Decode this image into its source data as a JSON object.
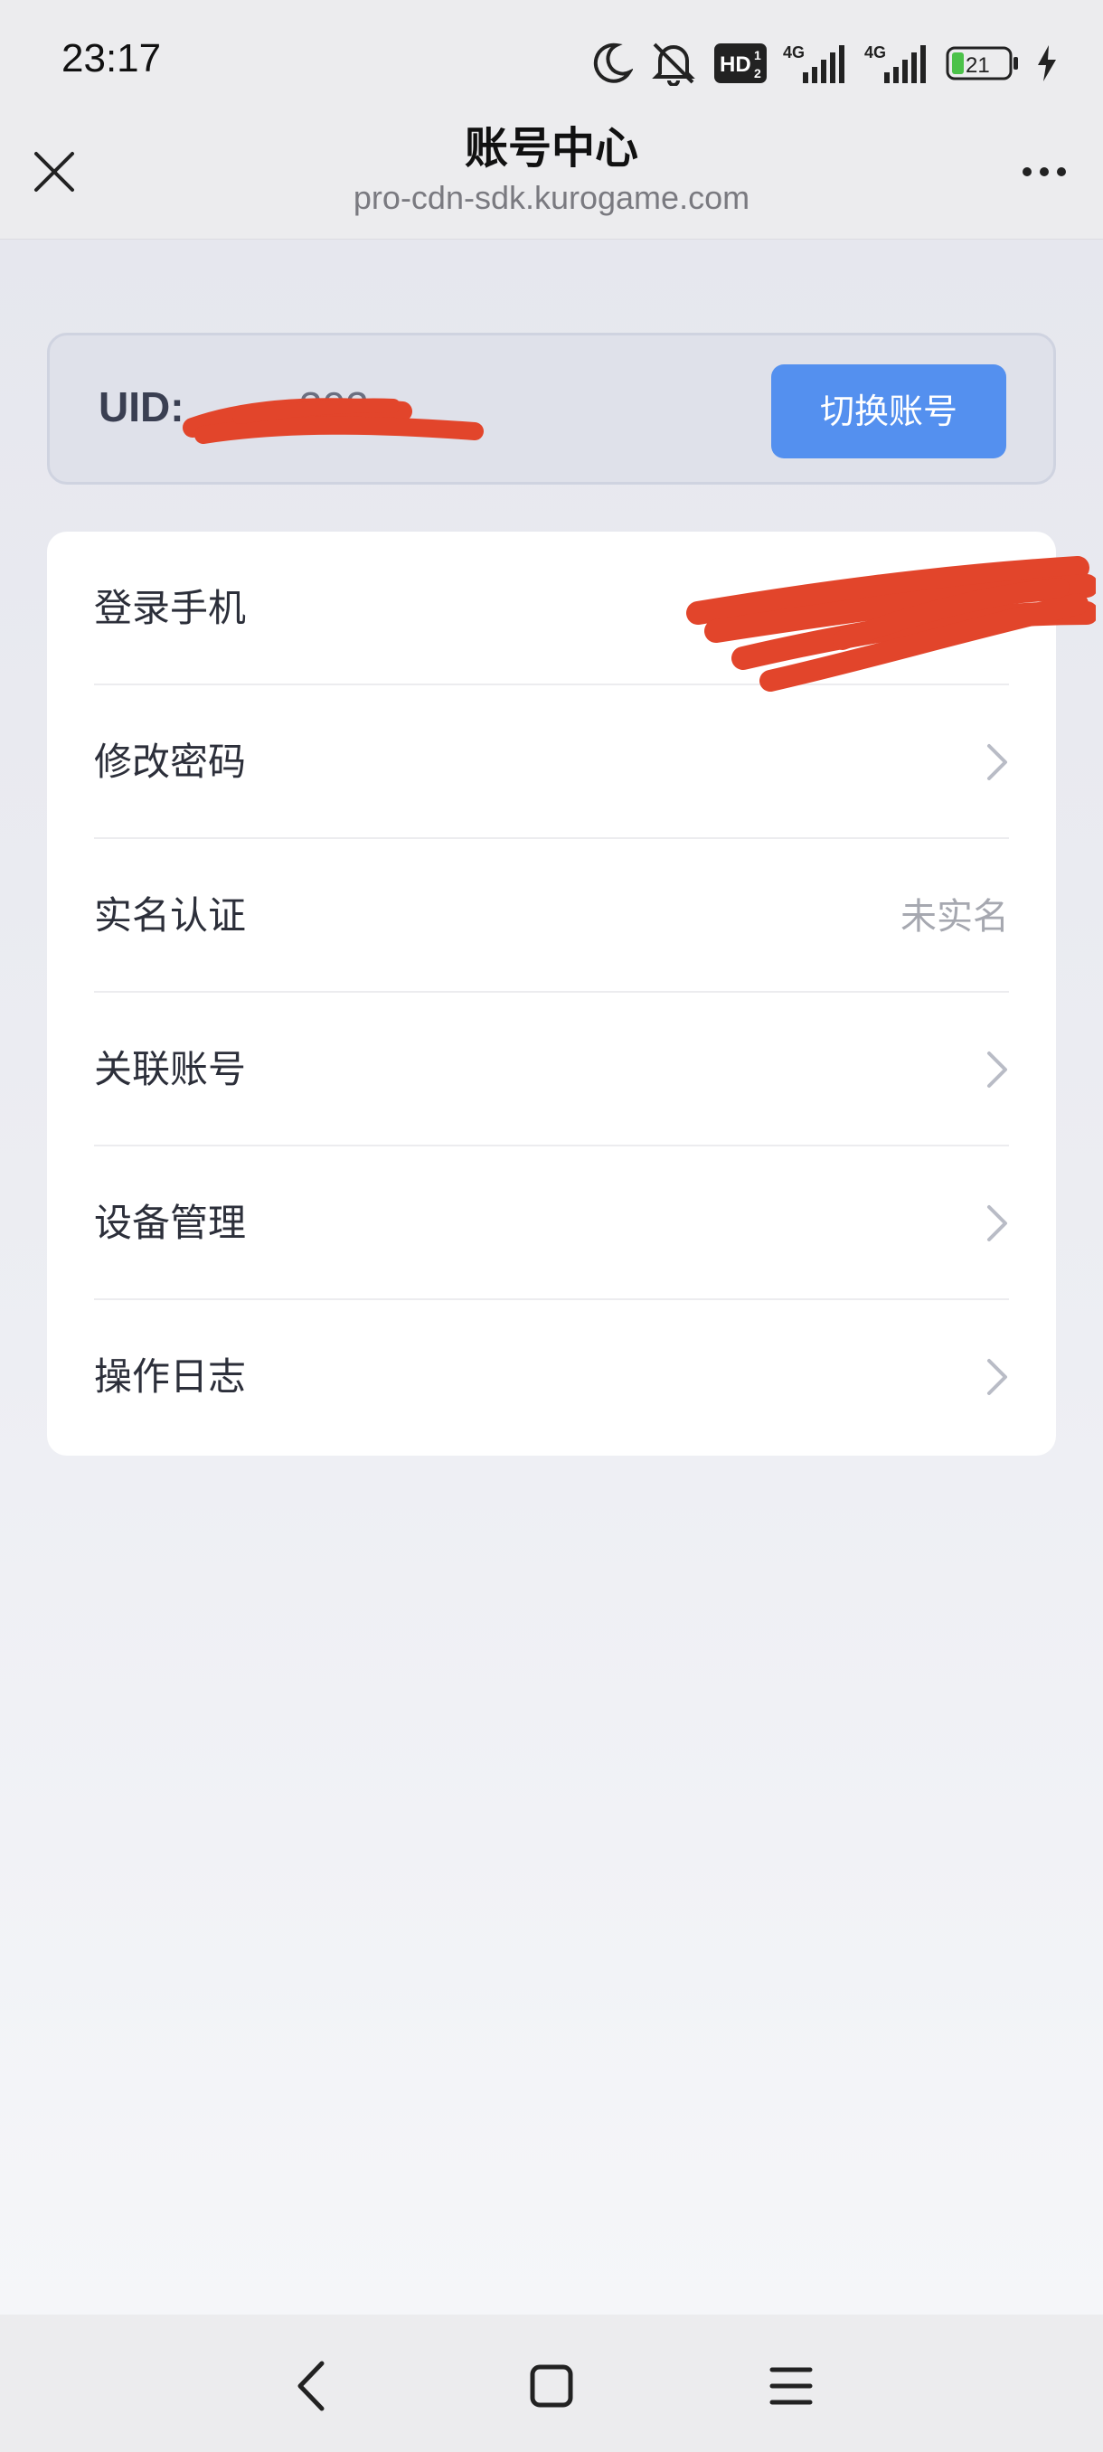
{
  "status": {
    "time": "23:17",
    "network_a": "4G",
    "network_b": "4G",
    "hd": "HD",
    "battery": "21"
  },
  "header": {
    "title": "账号中心",
    "subtitle": "pro-cdn-sdk.kurogame.com",
    "close_icon": "close-icon",
    "more_icon": "more-icon"
  },
  "account": {
    "uid_label": "UID:",
    "uid_tail": "302",
    "switch_label": "切换账号"
  },
  "menu": {
    "items": [
      {
        "label": "登录手机",
        "value": ""
      },
      {
        "label": "修改密码",
        "value": ""
      },
      {
        "label": "实名认证",
        "value": "未实名"
      },
      {
        "label": "关联账号",
        "value": ""
      },
      {
        "label": "设备管理",
        "value": ""
      },
      {
        "label": "操作日志",
        "value": ""
      }
    ]
  },
  "colors": {
    "accent": "#5490ef",
    "redaction": "#e2452b"
  }
}
